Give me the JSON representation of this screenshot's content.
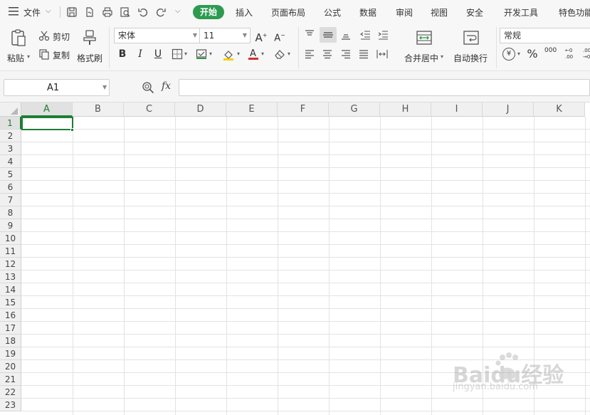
{
  "menubar": {
    "file_label": "文件",
    "tabs": [
      "开始",
      "插入",
      "页面布局",
      "公式",
      "数据",
      "审阅",
      "视图",
      "安全",
      "开发工具",
      "特色功能"
    ]
  },
  "ribbon": {
    "paste_label": "粘贴",
    "cut_label": "剪切",
    "copy_label": "复制",
    "format_painter_label": "格式刷",
    "font_name": "宋体",
    "font_size": "11",
    "merge_center_label": "合并居中",
    "wrap_text_label": "自动换行",
    "number_format": "常规",
    "bold_glyph": "B",
    "italic_glyph": "I",
    "underline_glyph": "U",
    "percent_glyph": "%",
    "thousands_glyph": "000",
    "inc_decimal_glyph": "+0 .00",
    "dec_decimal_glyph": ".00 →0",
    "currency_glyph": "¥"
  },
  "formula_bar": {
    "name_box": "A1",
    "fx_label": "fx",
    "formula_value": ""
  },
  "sheet": {
    "columns": [
      "A",
      "B",
      "C",
      "D",
      "E",
      "F",
      "G",
      "H",
      "I",
      "J",
      "K"
    ],
    "rows": [
      "1",
      "2",
      "3",
      "4",
      "5",
      "6",
      "7",
      "8",
      "9",
      "10",
      "11",
      "12",
      "13",
      "14",
      "15",
      "16",
      "17",
      "18",
      "19",
      "20",
      "21",
      "22",
      "23"
    ],
    "selected_cell": "A1",
    "selection_color": "#1e7e34"
  },
  "watermark": {
    "brand": "Baidu经验",
    "url": "jingyan.baidu.com"
  }
}
